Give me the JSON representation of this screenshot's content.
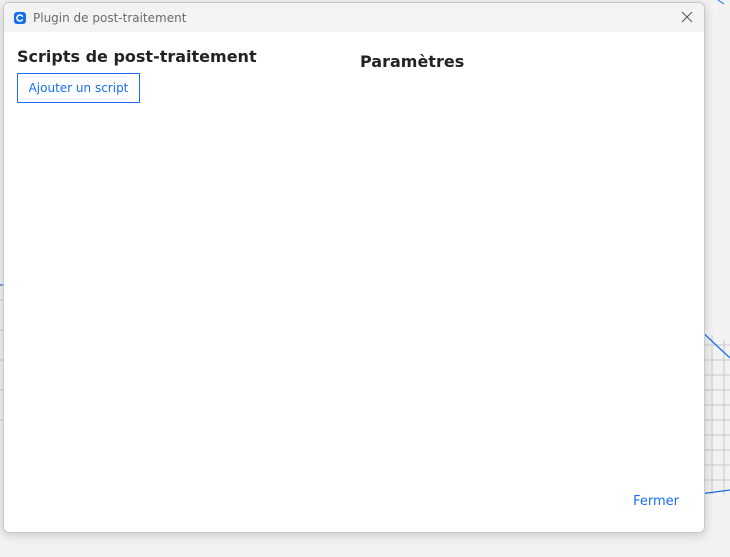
{
  "window": {
    "title": "Plugin de post-traitement",
    "app_icon": "cura-logo-icon",
    "close_icon": "close-icon"
  },
  "scripts_panel": {
    "heading": "Scripts de post-traitement",
    "add_button_label": "Ajouter un script"
  },
  "settings_panel": {
    "heading": "Paramètres"
  },
  "footer": {
    "close_label": "Fermer"
  },
  "colors": {
    "accent": "#196ef0",
    "title_bar": "#f3f3f3",
    "heading_text": "#232323"
  }
}
